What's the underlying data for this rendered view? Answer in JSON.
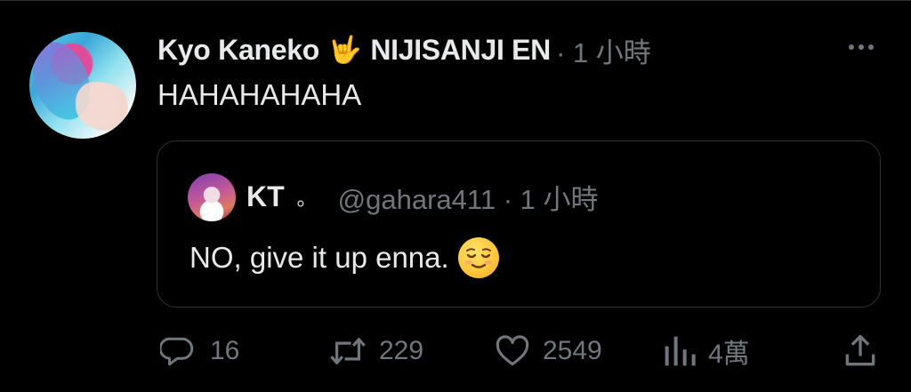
{
  "tweet": {
    "author_name": "Kyo Kaneko",
    "author_emoji": "🤟",
    "author_org": "NIJISANJI EN",
    "meta": "· 1 小時",
    "text": "HAHAHAHAHA"
  },
  "quoted": {
    "name": "KT",
    "dot": "。",
    "meta": "@gahara411 · 1 小時",
    "text": "NO, give it up enna."
  },
  "actions": {
    "replies": "16",
    "retweets": "229",
    "likes": "2549",
    "views": "4萬"
  },
  "icons": {
    "more": "more-dots-icon",
    "reply": "reply-bubble-icon",
    "retweet": "retweet-icon",
    "like": "heart-icon",
    "views": "views-chart-icon",
    "share": "share-upload-icon",
    "quote_emoji": "relieved-face-emoji"
  },
  "colors": {
    "background": "#000000",
    "text": "#e7e9ea",
    "secondary": "#71767b",
    "border": "#2f3336"
  }
}
